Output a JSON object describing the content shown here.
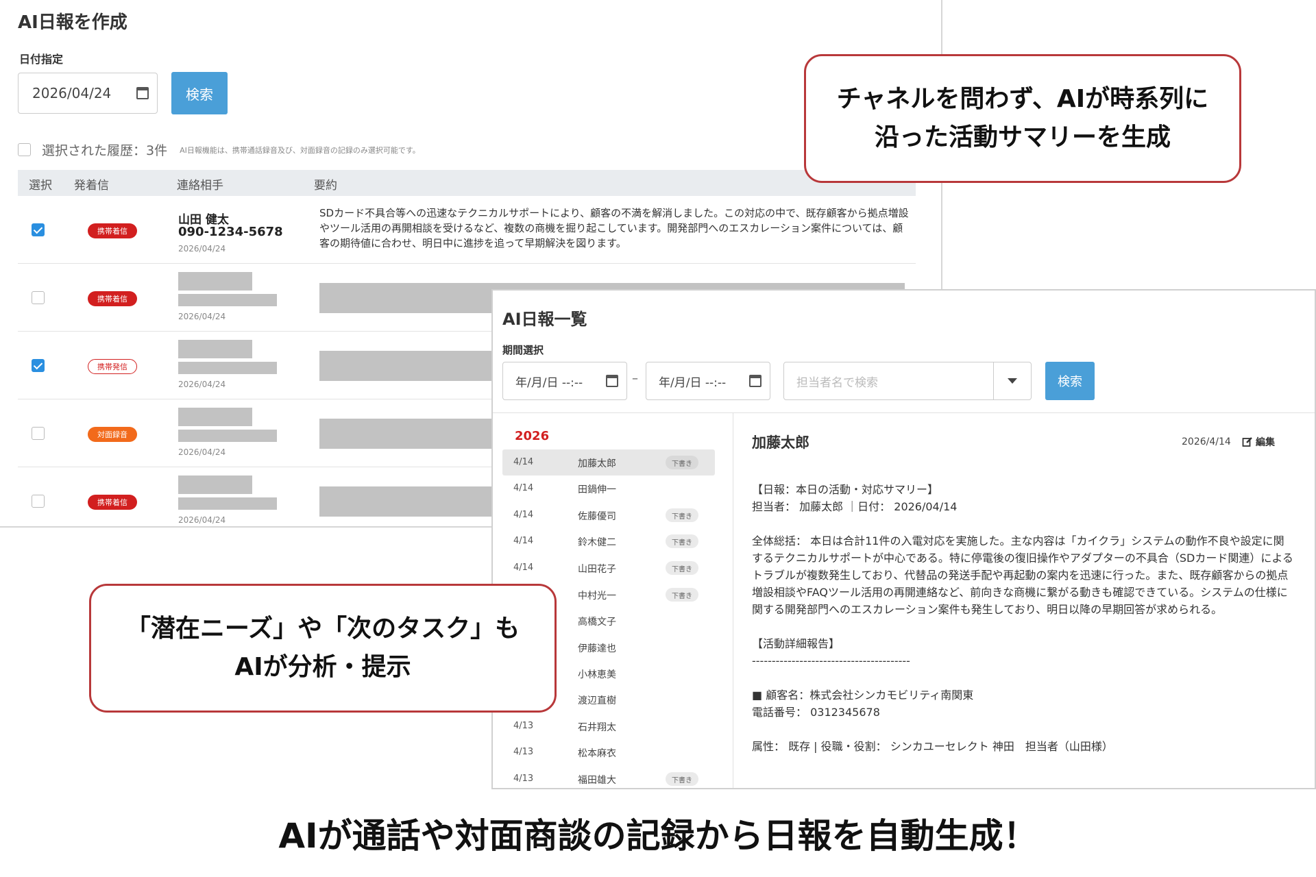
{
  "panel1": {
    "title": "AI日報を作成",
    "date_label": "日付指定",
    "date_value": "2026/04/24",
    "search_label": "検索",
    "selection_text": "選択された履歴：3件",
    "selection_note": "AI日報機能は、携帯通話録音及び、対面録音の記録のみ選択可能です。",
    "columns": [
      "選択",
      "発着信",
      "連絡相手",
      "要約"
    ],
    "rows": [
      {
        "checked": true,
        "badge": "携帯着信",
        "badge_style": "red",
        "name": "山田 健太",
        "phone": "090-1234-5678",
        "date": "2026/04/24",
        "summary": "SDカード不具合等への迅速なテクニカルサポートにより、顧客の不満を解消しました。この対応の中で、既存顧客から拠点増設やツール活用の再開相談を受けるなど、複数の商機を掘り起こしています。開発部門へのエスカレーション案件については、顧客の期待値に合わせ、明日中に進捗を追って早期解決を図ります。"
      },
      {
        "checked": false,
        "badge": "携帯着信",
        "badge_style": "red",
        "date": "2026/04/24"
      },
      {
        "checked": true,
        "badge": "携帯発信",
        "badge_style": "outline",
        "date": "2026/04/24"
      },
      {
        "checked": false,
        "badge": "対面録音",
        "badge_style": "orange",
        "date": "2026/04/24"
      },
      {
        "checked": false,
        "badge": "携帯着信",
        "badge_style": "red",
        "date": "2026/04/24"
      }
    ]
  },
  "panel2": {
    "title": "AI日報一覧",
    "period_label": "期間選択",
    "date_from": "年/月/日 --:--",
    "date_to": "年/月/日 --:--",
    "dash": "–",
    "assignee_placeholder": "担当者名で検索",
    "search_label": "検索",
    "year": "2026",
    "list": [
      {
        "date": "4/14",
        "name": "加藤太郎",
        "tag": "下書き"
      },
      {
        "date": "4/14",
        "name": "田鍋伸一",
        "tag": ""
      },
      {
        "date": "4/14",
        "name": "佐藤優司",
        "tag": "下書き"
      },
      {
        "date": "4/14",
        "name": "鈴木健二",
        "tag": "下書き"
      },
      {
        "date": "4/14",
        "name": "山田花子",
        "tag": "下書き"
      },
      {
        "date": "",
        "name": "中村光一",
        "tag": "下書き"
      },
      {
        "date": "",
        "name": "高橋文子",
        "tag": ""
      },
      {
        "date": "",
        "name": "伊藤達也",
        "tag": ""
      },
      {
        "date": "",
        "name": "小林恵美",
        "tag": ""
      },
      {
        "date": "",
        "name": "渡辺直樹",
        "tag": ""
      },
      {
        "date": "4/13",
        "name": "石井翔太",
        "tag": ""
      },
      {
        "date": "4/13",
        "name": "松本麻衣",
        "tag": ""
      },
      {
        "date": "4/13",
        "name": "福田雄大",
        "tag": "下書き"
      }
    ],
    "detail": {
      "person": "加藤太郎",
      "date": "2026/4/14",
      "edit_label": "編集",
      "lines": [
        "【日報：本日の活動・対応サマリー】",
        "担当者： 加藤太郎 ｜日付： 2026/04/14",
        "",
        "全体総括： 本日は合計11件の入電対応を実施した。主な内容は「カイクラ」システムの動作不良や設定に関するテクニカルサポートが中心である。特に停電後の復旧操作やアダプターの不具合（SDカード関連）によるトラブルが複数発生しており、代替品の発送手配や再起動の案内を迅速に行った。また、既存顧客からの拠点増設相談やFAQツール活用の再開連絡など、前向きな商機に繋がる動きも確認できている。システムの仕様に関する開発部門へのエスカレーション案件も発生しており、明日以降の早期回答が求められる。",
        "",
        "【活動詳細報告】",
        "----------------------------------------",
        "",
        "■ 顧客名：株式会社シンカモビリティ南関東",
        "電話番号： 0312345678",
        "",
        "属性： 既存 | 役職・役割： シンカユーセレクト 神田　担当者（山田様）"
      ]
    }
  },
  "callouts": {
    "top_right": [
      "チャネルを問わず、AIが時系列に",
      "沿った活動サマリーを生成"
    ],
    "bottom_left": [
      "「潜在ニーズ」や「次のタスク」も",
      "AIが分析・提示"
    ]
  },
  "footer_caption": "AIが通話や対面商談の記録から日報を自動生成！",
  "colors": {
    "accent_blue": "#4a9fd8",
    "badge_red": "#d21f1f",
    "badge_orange": "#f26a1b",
    "callout_border": "#b8383a",
    "check_blue": "#2a8fe0"
  }
}
